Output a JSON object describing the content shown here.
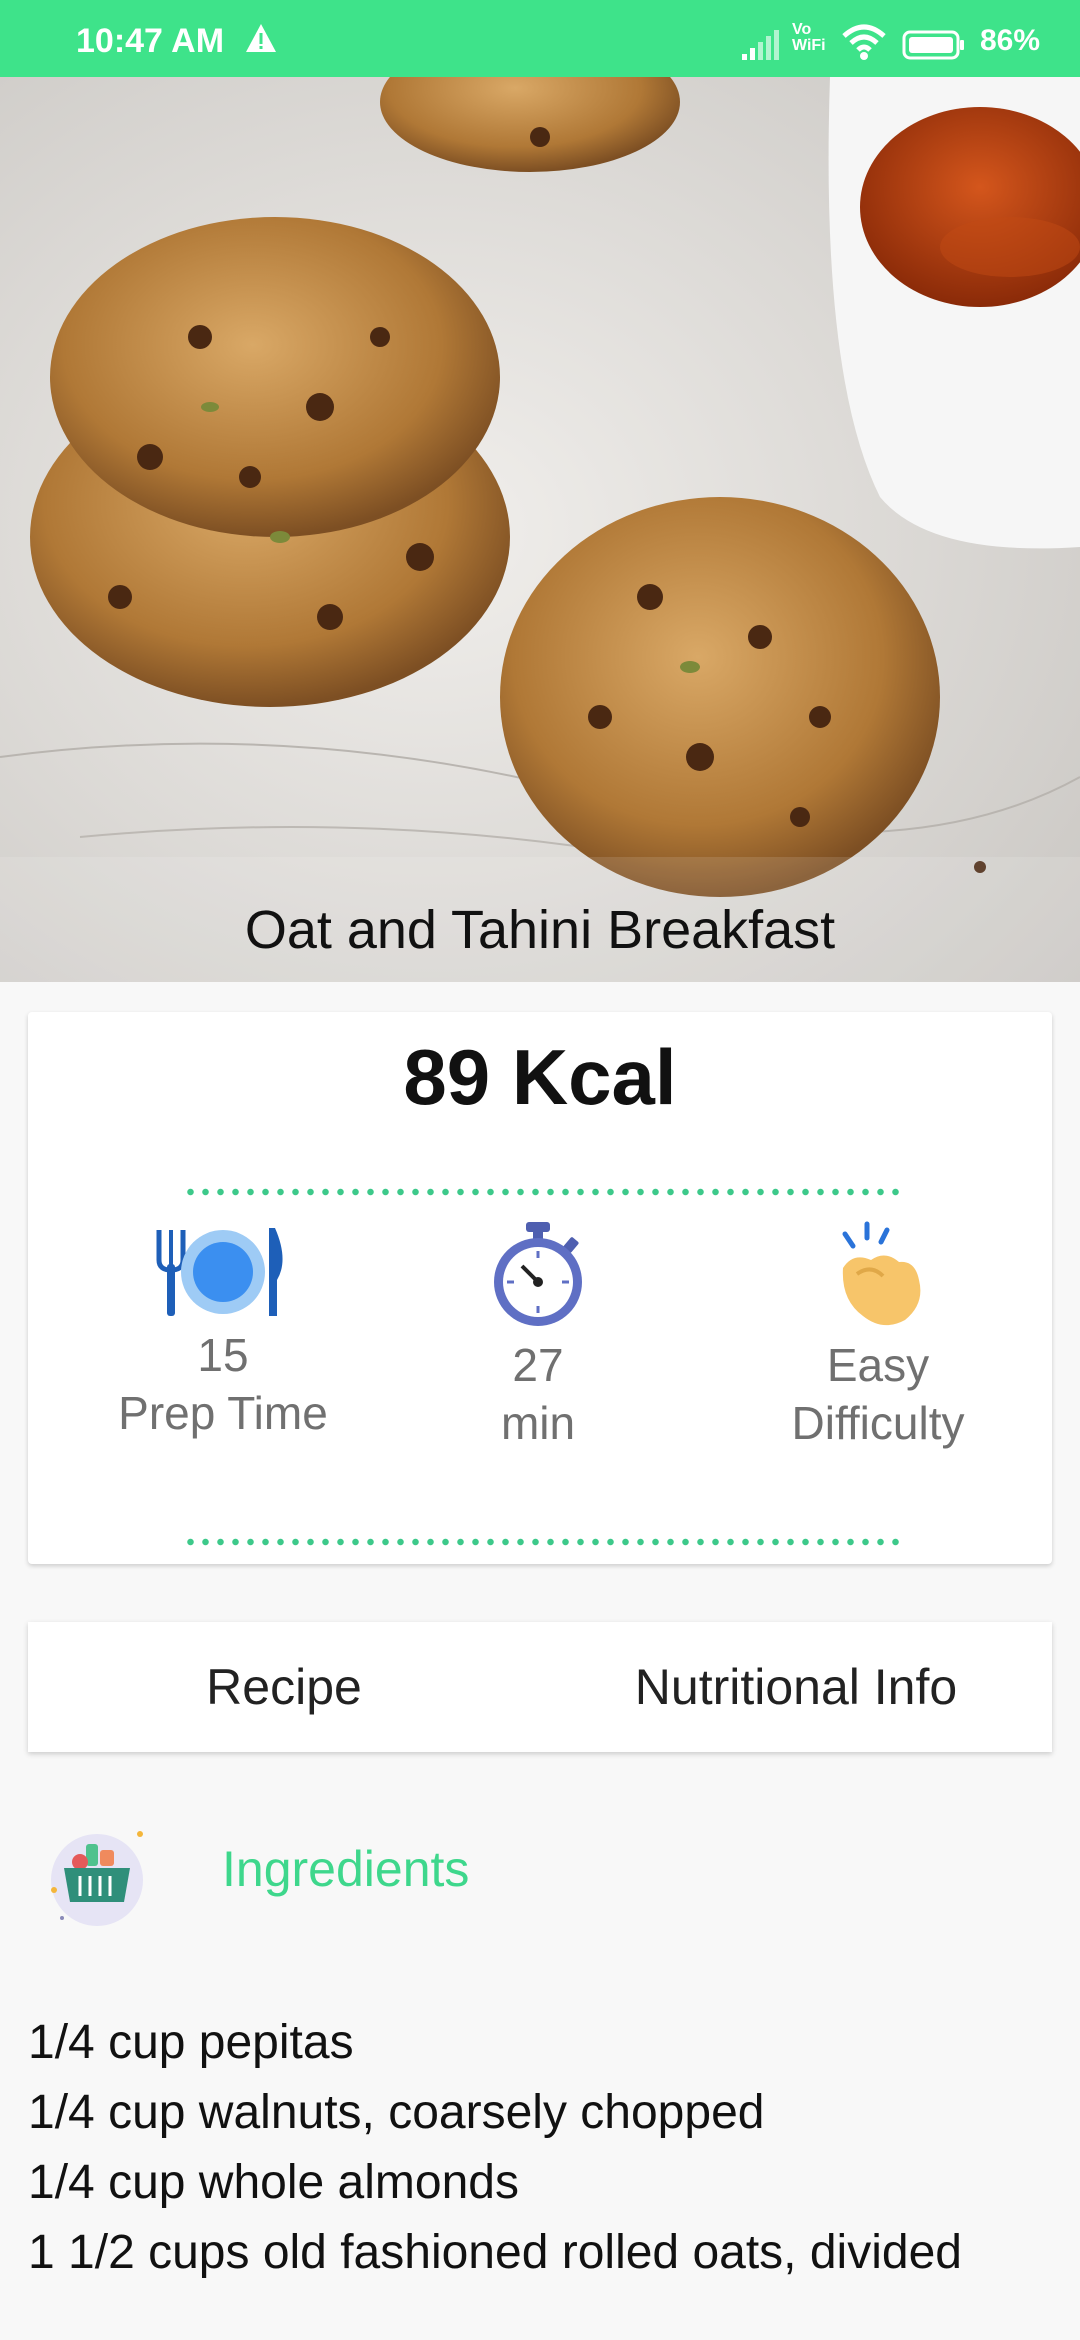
{
  "status_bar": {
    "time": "10:47 AM",
    "volte": "Vo\nWiFi",
    "battery": "86%"
  },
  "recipe": {
    "title": "Oat and Tahini Breakfast",
    "calories": "89 Kcal"
  },
  "stats": [
    {
      "icon": "plate-cutlery-icon",
      "value": "15",
      "label": "Prep Time"
    },
    {
      "icon": "stopwatch-icon",
      "value": "27",
      "label": "min"
    },
    {
      "icon": "snap-hand-icon",
      "value": "Easy",
      "label": "Difficulty"
    }
  ],
  "tabs": {
    "recipe": "Recipe",
    "nutrition": "Nutritional Info"
  },
  "ingredients": {
    "title": "Ingredients",
    "icon": "grocery-basket-icon",
    "items": [
      "1/4 cup pepitas",
      "1/4 cup walnuts, coarsely chopped",
      "1/4 cup whole almonds",
      "1 1/2 cups old fashioned rolled oats, divided"
    ]
  },
  "colors": {
    "accent": "#3ee38a",
    "ingredients_title": "#3ed78c",
    "dots": "#3dc98a"
  }
}
